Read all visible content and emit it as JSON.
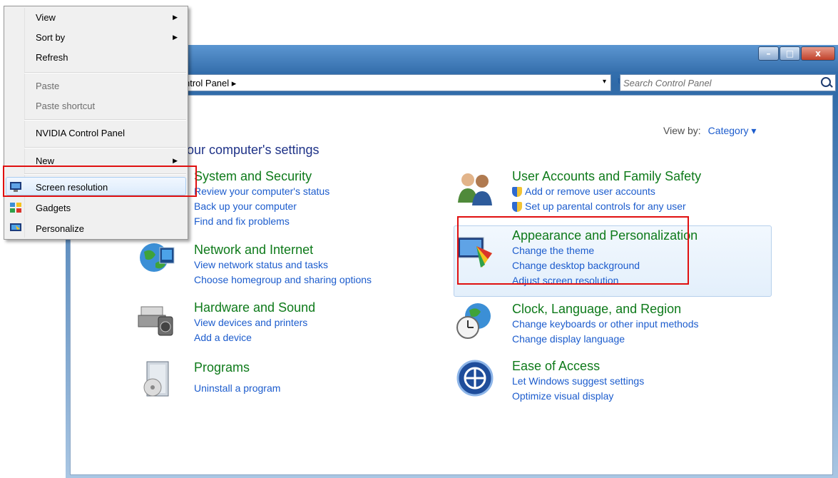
{
  "window": {
    "address": {
      "crumb": "ntrol Panel ▸",
      "dropdown_glyph": "▾",
      "refresh_glyph": "↻"
    },
    "search": {
      "placeholder": "Search Control Panel"
    },
    "buttons": {
      "minimize": "–",
      "maximize": "□",
      "close": "x"
    }
  },
  "page": {
    "title": "our computer's settings",
    "view_by_label": "View by:",
    "view_by_value": "Category ▾"
  },
  "categories": [
    {
      "heading": "System and Security",
      "links": [
        "Review your computer's status",
        "Back up your computer",
        "Find and fix problems"
      ],
      "icon": "shield-flag-icon"
    },
    {
      "heading": "Network and Internet",
      "links": [
        "View network status and tasks",
        "Choose homegroup and sharing options"
      ],
      "icon": "globe-network-icon"
    },
    {
      "heading": "Hardware and Sound",
      "links": [
        "View devices and printers",
        "Add a device"
      ],
      "icon": "printer-speaker-icon"
    },
    {
      "heading": "Programs",
      "links": [
        "Uninstall a program"
      ],
      "icon": "programs-box-icon"
    },
    {
      "heading": "User Accounts and Family Safety",
      "links": [
        "Add or remove user accounts",
        "Set up parental controls for any user"
      ],
      "icon": "users-icon"
    },
    {
      "heading": "Appearance and Personalization",
      "links": [
        "Change the theme",
        "Change desktop background",
        "Adjust screen resolution"
      ],
      "icon": "monitor-palette-icon"
    },
    {
      "heading": "Clock, Language, and Region",
      "links": [
        "Change keyboards or other input methods",
        "Change display language"
      ],
      "icon": "clock-globe-icon"
    },
    {
      "heading": "Ease of Access",
      "links": [
        "Let Windows suggest settings",
        "Optimize visual display"
      ],
      "icon": "ease-of-access-icon"
    }
  ],
  "context_menu": {
    "items": [
      {
        "label": "View",
        "submenu": true,
        "disabled": false
      },
      {
        "label": "Sort by",
        "submenu": true,
        "disabled": false
      },
      {
        "label": "Refresh",
        "submenu": false,
        "disabled": false
      },
      {
        "label": "Paste",
        "submenu": false,
        "disabled": true
      },
      {
        "label": "Paste shortcut",
        "submenu": false,
        "disabled": true
      },
      {
        "label": "NVIDIA Control Panel",
        "submenu": false,
        "disabled": false
      },
      {
        "label": "New",
        "submenu": true,
        "disabled": false
      },
      {
        "label": "Screen resolution",
        "submenu": false,
        "disabled": false,
        "icon": "screen-resolution-icon"
      },
      {
        "label": "Gadgets",
        "submenu": false,
        "disabled": false,
        "icon": "gadgets-icon"
      },
      {
        "label": "Personalize",
        "submenu": false,
        "disabled": false,
        "icon": "personalize-icon"
      }
    ],
    "submenu_glyph": "▶"
  },
  "colors": {
    "accent": "#1c5ccd",
    "heading_green": "#0e7a1a",
    "highlight_red": "#e01010",
    "title_blue": "#1e3287"
  }
}
